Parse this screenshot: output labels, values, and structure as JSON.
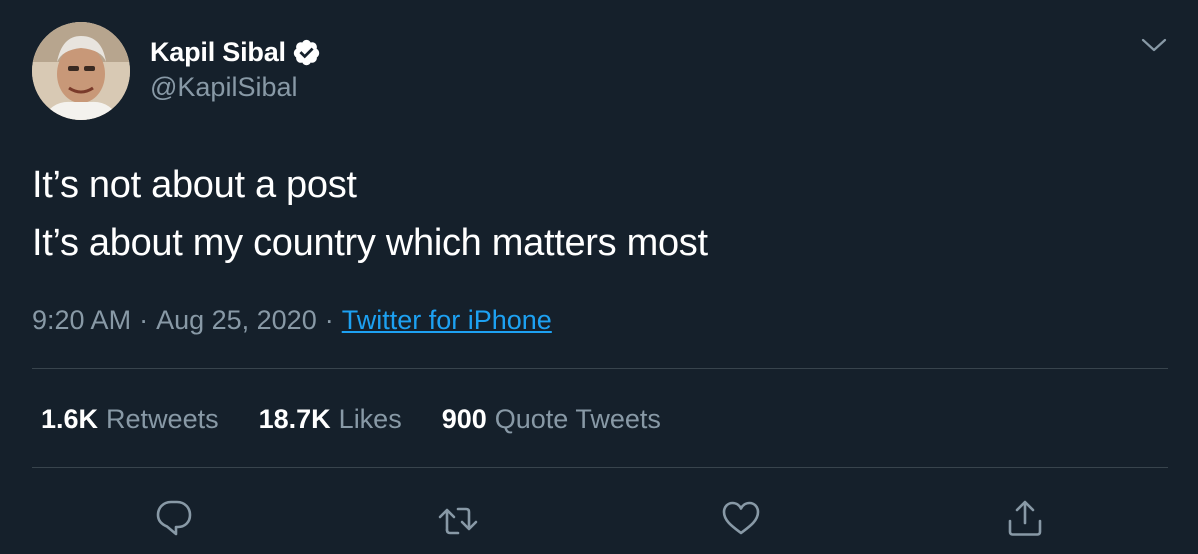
{
  "author": {
    "display_name": "Kapil Sibal",
    "handle": "@KapilSibal",
    "verified": true
  },
  "tweet": {
    "lines": [
      "It’s not about a post",
      "It’s about my country which matters most"
    ],
    "time": "9:20 AM",
    "date": "Aug 25, 2020",
    "source": "Twitter for iPhone",
    "separator": "·"
  },
  "stats": {
    "retweets": {
      "count": "1.6K",
      "label": "Retweets"
    },
    "likes": {
      "count": "18.7K",
      "label": "Likes"
    },
    "quotes": {
      "count": "900",
      "label": "Quote Tweets"
    }
  },
  "actions": {
    "reply_icon": "reply-icon",
    "retweet_icon": "retweet-icon",
    "like_icon": "heart-icon",
    "share_icon": "share-icon"
  },
  "colors": {
    "background": "#15202b",
    "primary_text": "#ffffff",
    "secondary_text": "#8899a6",
    "link": "#1da1f2",
    "divider": "#38444d"
  }
}
